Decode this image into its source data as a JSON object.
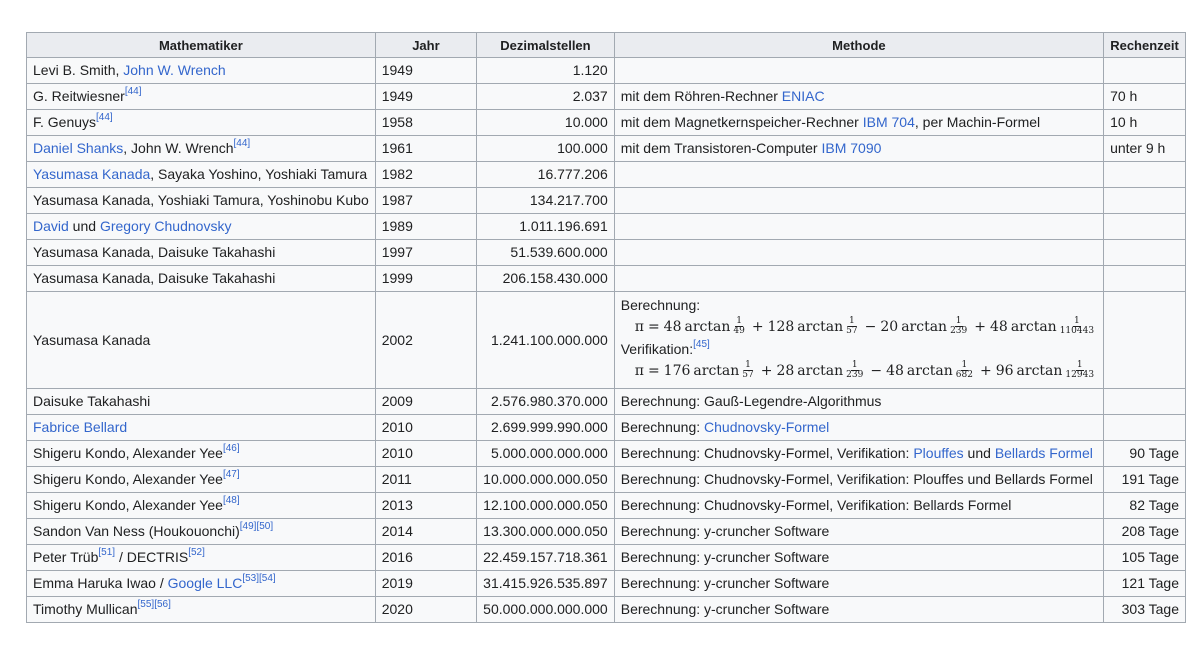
{
  "table": {
    "headers": [
      "Mathematiker",
      "Jahr",
      "Dezimalstellen",
      "Methode",
      "Rechenzeit"
    ],
    "rows": [
      {
        "math": [
          {
            "t": "Levi B. Smith, "
          },
          {
            "t": "John W. Wrench",
            "link": true
          }
        ],
        "jahr": "1949",
        "dez": "1.120",
        "methode": [],
        "zeit": "",
        "zeit_right": false
      },
      {
        "math": [
          {
            "t": "G. Reitwiesner"
          },
          {
            "t": "[44]",
            "sup": true
          }
        ],
        "jahr": "1949",
        "dez": "2.037",
        "methode": [
          {
            "t": "mit dem Röhren-Rechner "
          },
          {
            "t": "ENIAC",
            "link": true
          }
        ],
        "zeit": "70 h",
        "zeit_right": false
      },
      {
        "math": [
          {
            "t": "F. Genuys"
          },
          {
            "t": "[44]",
            "sup": true
          }
        ],
        "jahr": "1958",
        "dez": "10.000",
        "methode": [
          {
            "t": "mit dem Magnetkernspeicher-Rechner "
          },
          {
            "t": "IBM 704",
            "link": true
          },
          {
            "t": ", per Machin-Formel"
          }
        ],
        "zeit": "10 h",
        "zeit_right": false
      },
      {
        "math": [
          {
            "t": "Daniel Shanks",
            "link": true
          },
          {
            "t": ", John W. Wrench"
          },
          {
            "t": "[44]",
            "sup": true
          }
        ],
        "jahr": "1961",
        "dez": "100.000",
        "methode": [
          {
            "t": "mit dem Transistoren-Computer "
          },
          {
            "t": "IBM 7090",
            "link": true
          }
        ],
        "zeit": "unter 9 h",
        "zeit_right": false
      },
      {
        "math": [
          {
            "t": "Yasumasa Kanada",
            "link": true
          },
          {
            "t": ", Sayaka Yoshino, Yoshiaki Tamura"
          }
        ],
        "jahr": "1982",
        "dez": "16.777.206",
        "methode": [],
        "zeit": "",
        "zeit_right": false
      },
      {
        "math": [
          {
            "t": "Yasumasa Kanada, Yoshiaki Tamura, Yoshinobu Kubo"
          }
        ],
        "jahr": "1987",
        "dez": "134.217.700",
        "methode": [],
        "zeit": "",
        "zeit_right": false
      },
      {
        "math": [
          {
            "t": "David",
            "link": true
          },
          {
            "t": " und "
          },
          {
            "t": "Gregory Chudnovsky",
            "link": true
          }
        ],
        "jahr": "1989",
        "dez": "1.011.196.691",
        "methode": [],
        "zeit": "",
        "zeit_right": false
      },
      {
        "math": [
          {
            "t": "Yasumasa Kanada, Daisuke Takahashi"
          }
        ],
        "jahr": "1997",
        "dez": "51.539.600.000",
        "methode": [],
        "zeit": "",
        "zeit_right": false
      },
      {
        "math": [
          {
            "t": "Yasumasa Kanada, Daisuke Takahashi"
          }
        ],
        "jahr": "1999",
        "dez": "206.158.430.000",
        "methode": [],
        "zeit": "",
        "zeit_right": false
      },
      {
        "math": [
          {
            "t": "Yasumasa Kanada"
          }
        ],
        "jahr": "2002",
        "dez": "1.241.100.000.000",
        "formula_row": true,
        "zeit": "",
        "zeit_right": false
      },
      {
        "math": [
          {
            "t": "Daisuke Takahashi"
          }
        ],
        "jahr": "2009",
        "dez": "2.576.980.370.000",
        "methode": [
          {
            "t": "Berechnung: Gauß-Legendre-Algorithmus"
          }
        ],
        "zeit": "",
        "zeit_right": false
      },
      {
        "math": [
          {
            "t": "Fabrice Bellard",
            "link": true
          }
        ],
        "jahr": "2010",
        "dez": "2.699.999.990.000",
        "methode": [
          {
            "t": "Berechnung: "
          },
          {
            "t": "Chudnovsky-Formel",
            "link": true
          }
        ],
        "zeit": "",
        "zeit_right": false
      },
      {
        "math": [
          {
            "t": "Shigeru Kondo, Alexander Yee"
          },
          {
            "t": "[46]",
            "sup": true
          }
        ],
        "jahr": "2010",
        "dez": "5.000.000.000.000",
        "methode": [
          {
            "t": "Berechnung: Chudnovsky-Formel, Verifikation: "
          },
          {
            "t": "Plouffes",
            "link": true
          },
          {
            "t": " und "
          },
          {
            "t": "Bellards Formel",
            "link": true
          }
        ],
        "zeit": "90 Tage",
        "zeit_right": true
      },
      {
        "math": [
          {
            "t": "Shigeru Kondo, Alexander Yee"
          },
          {
            "t": "[47]",
            "sup": true
          }
        ],
        "jahr": "2011",
        "dez": "10.000.000.000.050",
        "methode": [
          {
            "t": "Berechnung: Chudnovsky-Formel, Verifikation: Plouffes und Bellards Formel"
          }
        ],
        "zeit": "191 Tage",
        "zeit_right": true
      },
      {
        "math": [
          {
            "t": "Shigeru Kondo, Alexander Yee"
          },
          {
            "t": "[48]",
            "sup": true
          }
        ],
        "jahr": "2013",
        "dez": "12.100.000.000.050",
        "methode": [
          {
            "t": "Berechnung: Chudnovsky-Formel, Verifikation: Bellards Formel"
          }
        ],
        "zeit": "82 Tage",
        "zeit_right": true
      },
      {
        "math": [
          {
            "t": "Sandon Van Ness (Houkouonchi)"
          },
          {
            "t": "[49]",
            "sup": true
          },
          {
            "t": "[50]",
            "sup": true
          }
        ],
        "jahr": "2014",
        "dez": "13.300.000.000.050",
        "methode": [
          {
            "t": "Berechnung: y-cruncher Software"
          }
        ],
        "zeit": "208 Tage",
        "zeit_right": true
      },
      {
        "math": [
          {
            "t": "Peter Trüb"
          },
          {
            "t": "[51]",
            "sup": true
          },
          {
            "t": " / DECTRIS"
          },
          {
            "t": "[52]",
            "sup": true
          }
        ],
        "jahr": "2016",
        "dez": "22.459.157.718.361",
        "methode": [
          {
            "t": "Berechnung: y-cruncher Software"
          }
        ],
        "zeit": "105 Tage",
        "zeit_right": true
      },
      {
        "math": [
          {
            "t": "Emma Haruka Iwao / "
          },
          {
            "t": "Google LLC",
            "link": true
          },
          {
            "t": "[53]",
            "sup": true
          },
          {
            "t": "[54]",
            "sup": true
          }
        ],
        "jahr": "2019",
        "dez": "31.415.926.535.897",
        "methode": [
          {
            "t": "Berechnung: y-cruncher Software"
          }
        ],
        "zeit": "121 Tage",
        "zeit_right": true
      },
      {
        "math": [
          {
            "t": "Timothy Mullican"
          },
          {
            "t": "[55]",
            "sup": true
          },
          {
            "t": "[56]",
            "sup": true
          }
        ],
        "jahr": "2020",
        "dez": "50.000.000.000.000",
        "methode": [
          {
            "t": "Berechnung: y-cruncher Software"
          }
        ],
        "zeit": "303 Tage",
        "zeit_right": true
      }
    ],
    "formula_cell": {
      "berechnung_label": "Berechnung:",
      "verifikation_label": "Verifikation:",
      "verifikation_ref": "[45]",
      "pi": "π",
      "eq": "=",
      "arctan": "arctan",
      "f1": [
        {
          "sign": "",
          "coef": "48",
          "num": "1",
          "den": "49"
        },
        {
          "sign": "+",
          "coef": "128",
          "num": "1",
          "den": "57"
        },
        {
          "sign": "−",
          "coef": "20",
          "num": "1",
          "den": "239"
        },
        {
          "sign": "+",
          "coef": "48",
          "num": "1",
          "den": "110443"
        }
      ],
      "f2": [
        {
          "sign": "",
          "coef": "176",
          "num": "1",
          "den": "57"
        },
        {
          "sign": "+",
          "coef": "28",
          "num": "1",
          "den": "239"
        },
        {
          "sign": "−",
          "coef": "48",
          "num": "1",
          "den": "682"
        },
        {
          "sign": "+",
          "coef": "96",
          "num": "1",
          "den": "12943"
        }
      ]
    }
  }
}
